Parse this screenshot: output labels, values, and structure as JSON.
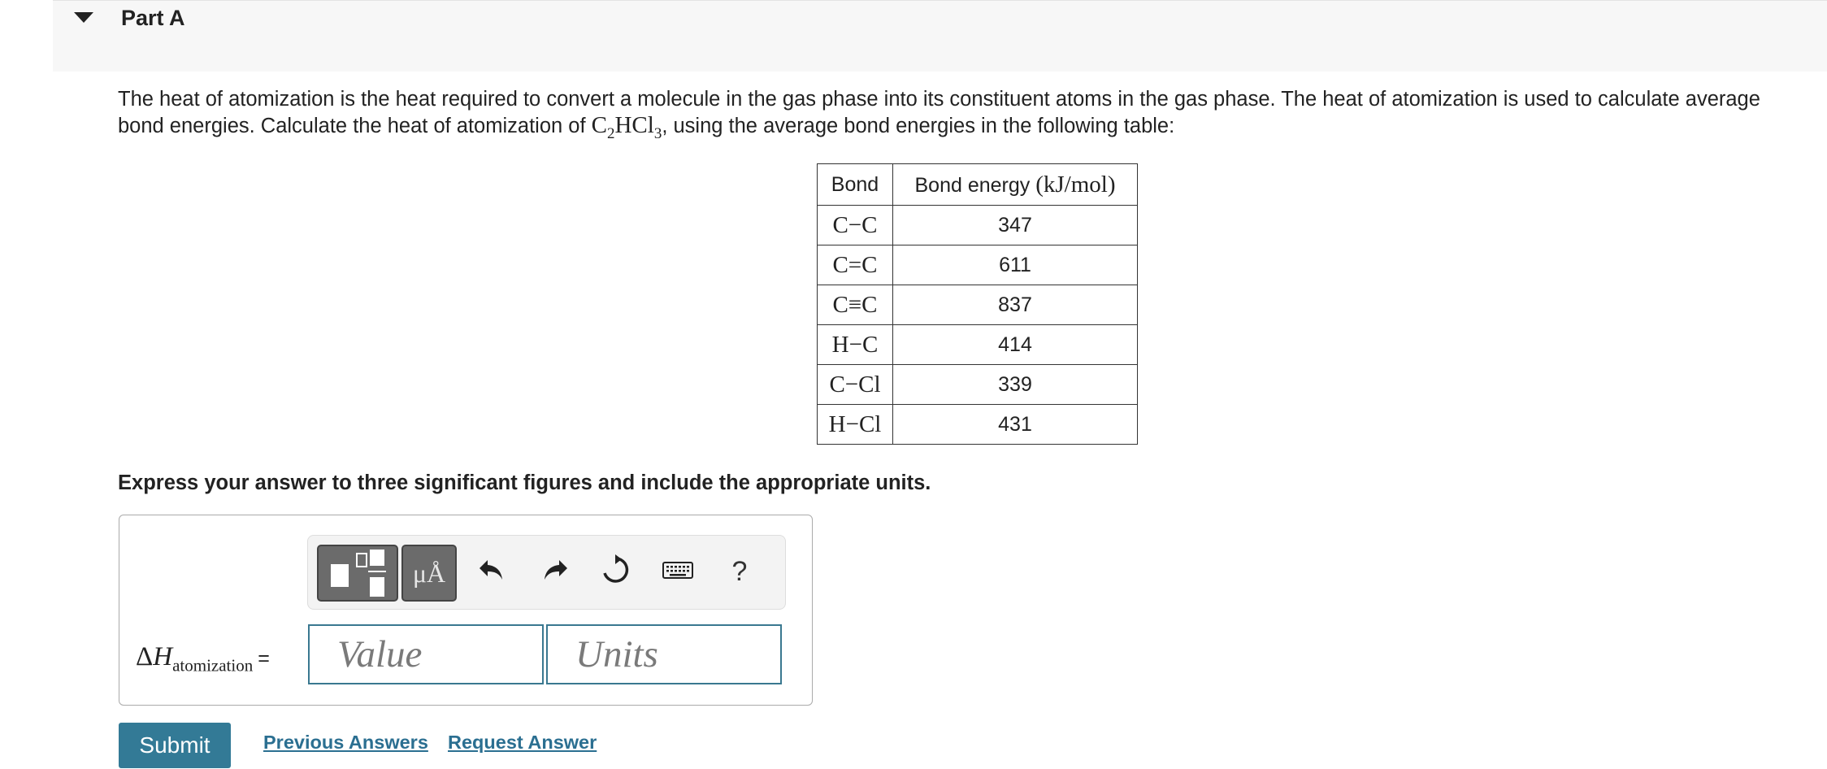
{
  "part": {
    "title": "Part A"
  },
  "prompt": {
    "text_before": "The heat of atomization is the heat required to convert a molecule in the gas phase into its constituent atoms in the gas phase. The heat of atomization is used to calculate average bond energies. Calculate the heat of atomization of ",
    "formula_c": "C",
    "formula_c_sub": "2",
    "formula_hcl": "HCl",
    "formula_hcl_sub": "3",
    "text_after": ", using the average bond energies in the following table:"
  },
  "table": {
    "header_bond": "Bond",
    "header_energy": "Bond energy",
    "header_units": "(kJ/mol)",
    "rows": [
      {
        "bond": "C−C",
        "energy": "347"
      },
      {
        "bond": "C=C",
        "energy": "611"
      },
      {
        "bond": "C≡C",
        "energy": "837"
      },
      {
        "bond": "H−C",
        "energy": "414"
      },
      {
        "bond": "C−Cl",
        "energy": "339"
      },
      {
        "bond": "H−Cl",
        "energy": "431"
      }
    ]
  },
  "instruction": "Express your answer to three significant figures and include the appropriate units.",
  "toolbar": {
    "units_label": "μÅ",
    "help_label": "?",
    "icons": [
      "templates-icon",
      "units-icon",
      "undo-icon",
      "redo-icon",
      "reset-icon",
      "keyboard-icon",
      "help-icon"
    ]
  },
  "answer": {
    "delta": "Δ",
    "symbol": "H",
    "subscript": "atomization",
    "equals": "=",
    "value_placeholder": "Value",
    "units_placeholder": "Units"
  },
  "actions": {
    "submit": "Submit",
    "previous_answers": "Previous Answers",
    "request_answer": "Request Answer"
  },
  "colors": {
    "accent": "#337a96",
    "link": "#2b6f91",
    "field_border": "#3a7890"
  }
}
